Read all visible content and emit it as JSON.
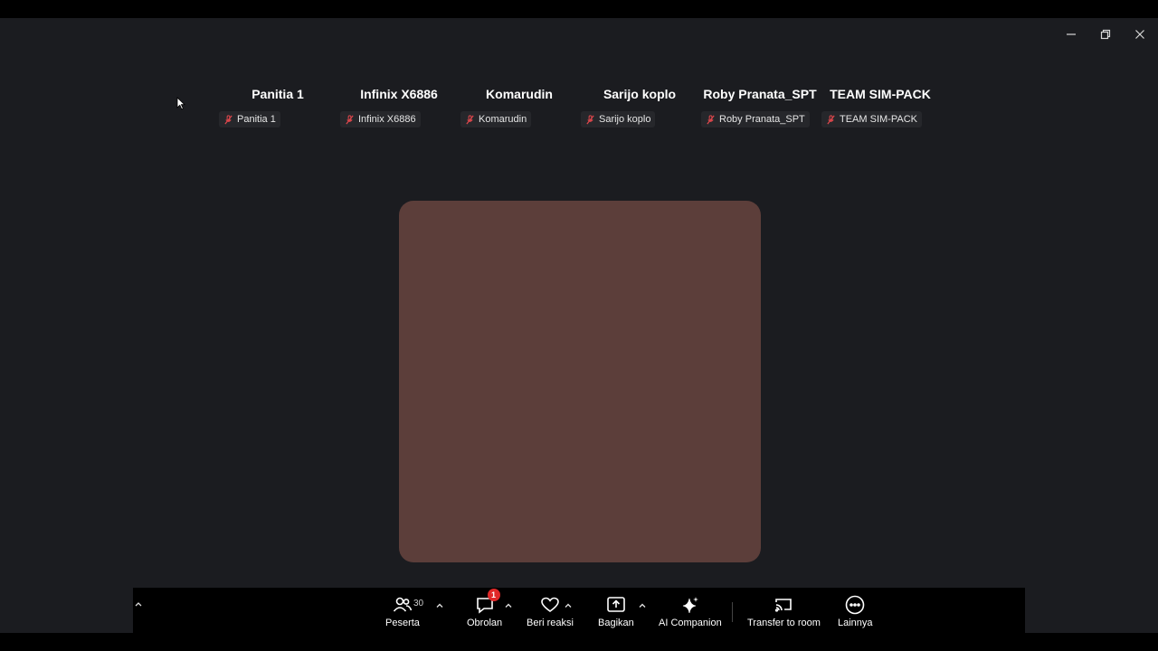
{
  "participants": [
    {
      "name": "Panitia 1",
      "tag": "Panitia 1"
    },
    {
      "name": "Infinix X6886",
      "tag": "Infinix X6886"
    },
    {
      "name": "Komarudin",
      "tag": "Komarudin"
    },
    {
      "name": "Sarijo koplo",
      "tag": "Sarijo koplo"
    },
    {
      "name": "Roby Pranata_SPT",
      "tag": "Roby Pranata_SPT"
    },
    {
      "name": "TEAM SIM-PACK",
      "tag": "TEAM SIM-PACK"
    }
  ],
  "toolbar": {
    "participants_label": "Peserta",
    "participants_count": "30",
    "chat_label": "Obrolan",
    "chat_badge": "1",
    "reactions_label": "Beri reaksi",
    "share_label": "Bagikan",
    "ai_label": "AI Companion",
    "transfer_label": "Transfer to room",
    "more_label": "Lainnya"
  },
  "colors": {
    "background": "#1b1c20",
    "video_tile": "#5c3e3a",
    "muted_icon": "#e0474c",
    "badge": "#e02828"
  },
  "icons": {
    "minimize": "minimize-icon",
    "restore": "restore-icon",
    "close": "close-icon",
    "muted": "mic-muted-icon"
  }
}
